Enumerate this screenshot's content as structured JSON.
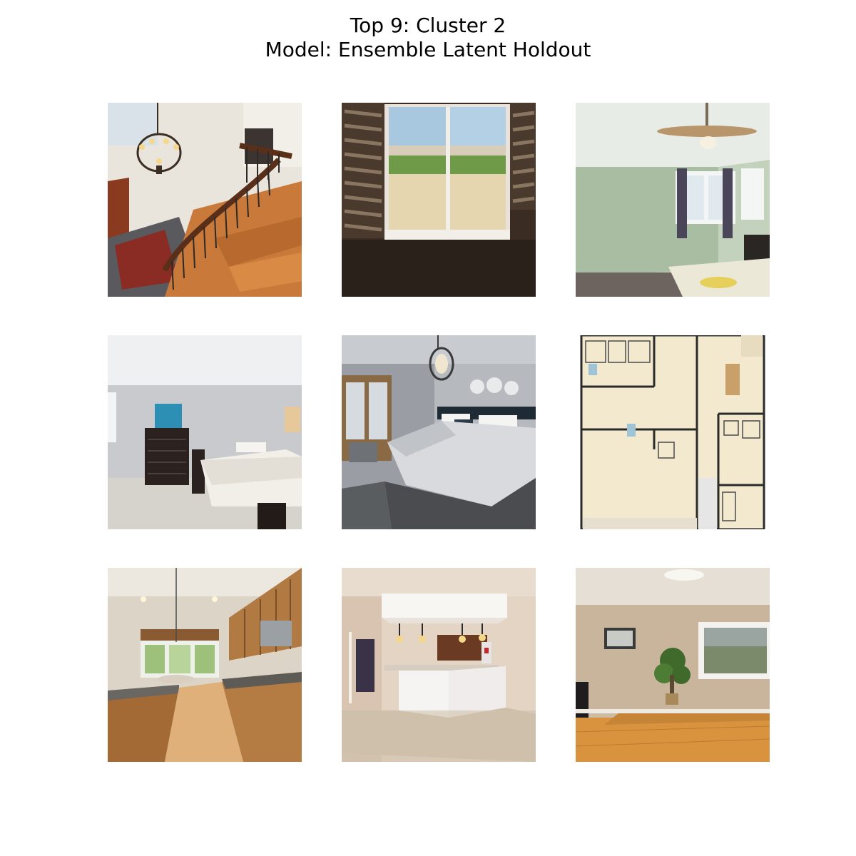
{
  "figure": {
    "title_line_1": "Top 9: Cluster 2",
    "title_line_2": "Model: Ensemble Latent Holdout"
  },
  "images": [
    {
      "row": 1,
      "col": 1,
      "scene": "staircase-foyer-with-chandelier"
    },
    {
      "row": 1,
      "col": 2,
      "scene": "window-with-shutters"
    },
    {
      "row": 1,
      "col": 3,
      "scene": "bedroom-with-ceiling-fan"
    },
    {
      "row": 2,
      "col": 1,
      "scene": "bedroom-with-dresser"
    },
    {
      "row": 2,
      "col": 2,
      "scene": "bedroom-with-pendant-light"
    },
    {
      "row": 2,
      "col": 3,
      "scene": "floor-plan"
    },
    {
      "row": 3,
      "col": 1,
      "scene": "kitchen-with-wood-cabinets"
    },
    {
      "row": 3,
      "col": 2,
      "scene": "kitchen-bar-with-pendants"
    },
    {
      "row": 3,
      "col": 3,
      "scene": "empty-room-with-window"
    }
  ]
}
